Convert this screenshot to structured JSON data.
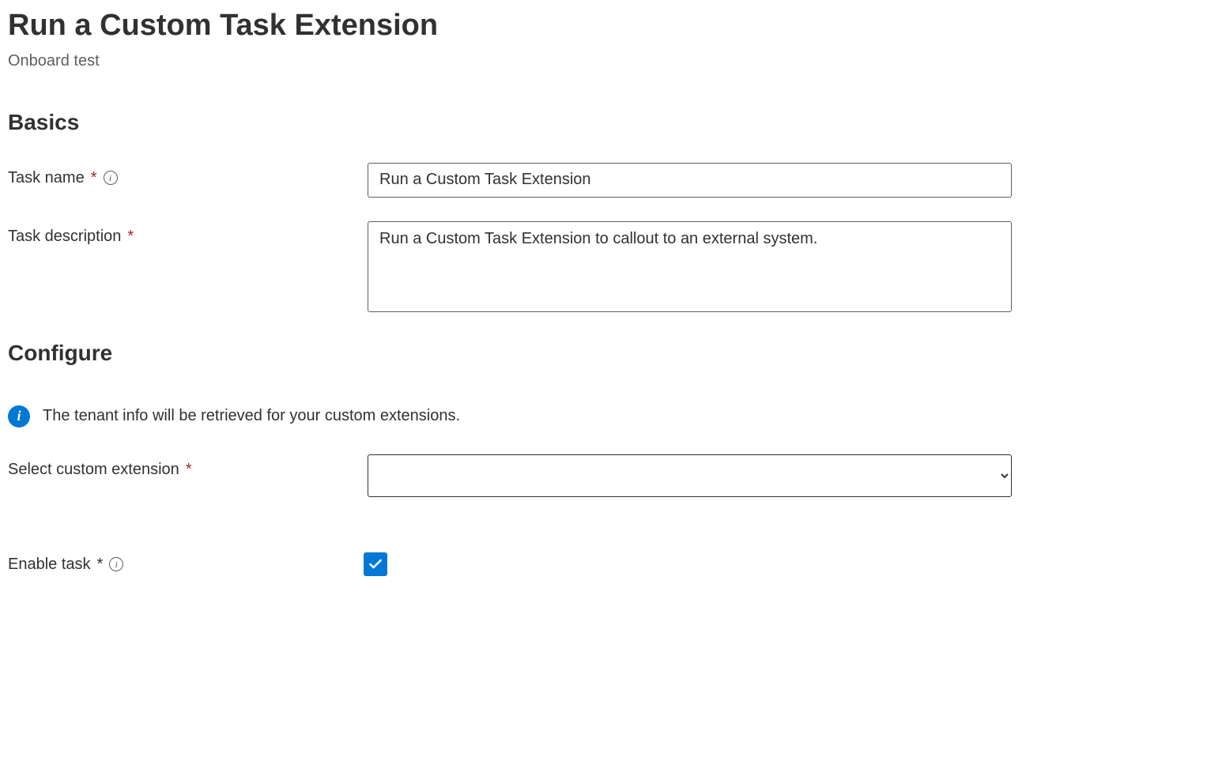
{
  "header": {
    "title": "Run a Custom Task Extension",
    "subtitle": "Onboard test"
  },
  "sections": {
    "basics_heading": "Basics",
    "configure_heading": "Configure"
  },
  "basics": {
    "task_name_label": "Task name",
    "task_name_value": "Run a Custom Task Extension",
    "task_description_label": "Task description",
    "task_description_value": "Run a Custom Task Extension to callout to an external system."
  },
  "configure": {
    "info_text": "The tenant info will be retrieved for your custom extensions.",
    "select_extension_label": "Select custom extension",
    "select_extension_value": "",
    "enable_task_label": "Enable task",
    "enable_task_checked": true
  }
}
